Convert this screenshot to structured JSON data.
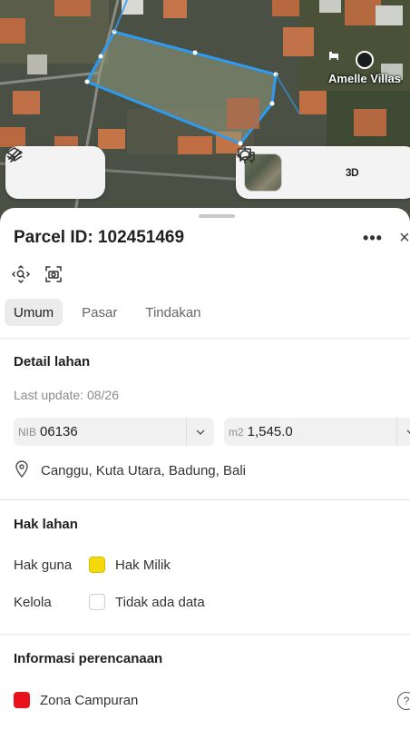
{
  "map": {
    "poi_label": "Amelle Villas",
    "poi_icon": "bed-icon",
    "tools_left": [
      {
        "icon": "layers-icon"
      },
      {
        "icon": "measure-icon"
      }
    ],
    "tools_right": {
      "basemap_icon": "satellite-thumbnail",
      "locate_icon": "crosshair-icon",
      "btn_3d_label": "3D",
      "feedback_icon": "chat-icon"
    }
  },
  "sheet": {
    "title": "Parcel ID: 102451469",
    "more_icon": "more-icon",
    "close_label": "×",
    "icons": [
      "zoom-to-icon",
      "screenshot-icon"
    ],
    "tabs": [
      {
        "label": "Umum",
        "active": true
      },
      {
        "label": "Pasar",
        "active": false
      },
      {
        "label": "Tindakan",
        "active": false
      }
    ]
  },
  "detail": {
    "title": "Detail lahan",
    "last_update": "Last update: 08/26",
    "nib": {
      "label": "NIB",
      "value": "06136"
    },
    "area": {
      "label": "m2",
      "value": "1,545.0"
    },
    "location": "Canggu, Kuta Utara, Badung, Bali"
  },
  "rights": {
    "title": "Hak lahan",
    "rows": [
      {
        "key": "Hak guna",
        "value": "Hak Milik",
        "color": "#f5d90a"
      },
      {
        "key": "Kelola",
        "value": "Tidak ada data",
        "color": "#ffffff"
      }
    ]
  },
  "planning": {
    "title": "Informasi perencanaan",
    "zone": "Zona Campuran",
    "zone_color": "#e8131a"
  }
}
